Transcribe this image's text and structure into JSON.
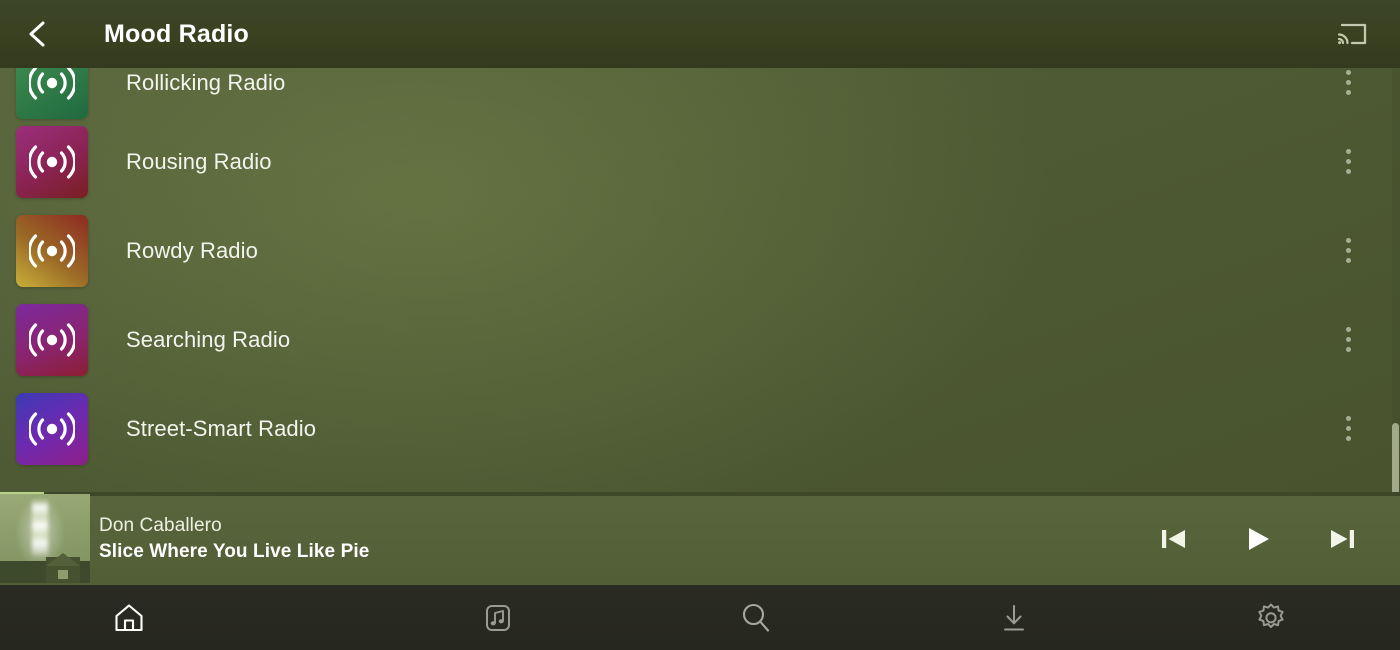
{
  "header": {
    "title": "Mood Radio",
    "back_icon": "chevron-left-icon",
    "cast_icon": "cast-icon"
  },
  "list": {
    "items": [
      {
        "label": "Rollicking Radio",
        "icon": "radio-waves-icon",
        "art_from": "#3f8f52",
        "art_via": "#2f7a47",
        "art_to": "#1f6b3f",
        "menu_icon": "more-vertical-icon"
      },
      {
        "label": "Rousing Radio",
        "icon": "radio-waves-icon",
        "art_from": "#9b2f7d",
        "art_via": "#8a2352",
        "art_to": "#7a1f22",
        "menu_icon": "more-vertical-icon"
      },
      {
        "label": "Rowdy Radio",
        "icon": "radio-waves-icon",
        "art_from": "#8e2a22",
        "art_via": "#9a6a26",
        "art_to": "#c9b03a",
        "menu_icon": "more-vertical-icon"
      },
      {
        "label": "Searching Radio",
        "icon": "radio-waves-icon",
        "art_from": "#7c2a9e",
        "art_via": "#8a2470",
        "art_to": "#8c1f33",
        "menu_icon": "more-vertical-icon"
      },
      {
        "label": "Street-Smart Radio",
        "icon": "radio-waves-icon",
        "art_from": "#3b3ab5",
        "art_via": "#6d2ab0",
        "art_to": "#8f1f8a",
        "menu_icon": "more-vertical-icon"
      }
    ]
  },
  "player": {
    "artist": "Don Caballero",
    "track": "Slice Where You Live Like Pie",
    "progress_percent": 3,
    "progress_color": "#b7d188",
    "album_art_icon": "lighthouse-album-art",
    "controls": [
      {
        "name": "previous-track-button",
        "icon": "skip-previous-icon"
      },
      {
        "name": "play-button",
        "icon": "play-icon"
      },
      {
        "name": "next-track-button",
        "icon": "skip-next-icon"
      }
    ]
  },
  "navbar": {
    "items": [
      {
        "name": "nav-home",
        "icon": "home-icon",
        "active": true
      },
      {
        "name": "nav-library",
        "icon": "music-library-icon",
        "active": false
      },
      {
        "name": "nav-search",
        "icon": "search-icon",
        "active": false
      },
      {
        "name": "nav-downloads",
        "icon": "download-icon",
        "active": false
      },
      {
        "name": "nav-settings",
        "icon": "gear-icon",
        "active": false
      }
    ]
  },
  "colors": {
    "header_bg": "#3a4226",
    "list_bg": "#4e5a33",
    "player_bg": "#55613a",
    "navbar_bg": "#26271f",
    "text_primary": "#ffffff"
  }
}
